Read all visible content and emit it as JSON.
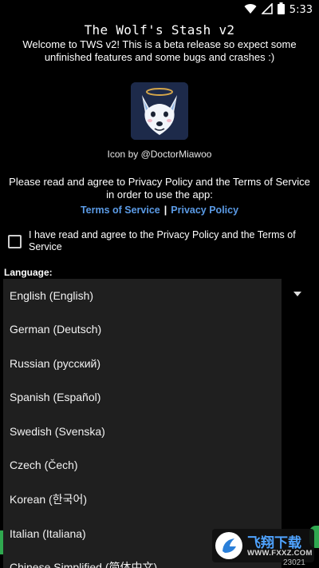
{
  "status_bar": {
    "time": "5:33",
    "icons": [
      "wifi-icon",
      "signal-icon",
      "battery-icon"
    ]
  },
  "app": {
    "title": "The Wolf's Stash v2",
    "welcome": "Welcome to TWS v2! This is a beta release so expect some unfinished features and some bugs and crashes :)",
    "icon_credit": "Icon by @DoctorMiawoo",
    "agree_prompt": "Please read and agree to Privacy Policy and the Terms of Service in order to use the app:",
    "links": {
      "terms": "Terms of Service",
      "separator": "|",
      "privacy": "Privacy Policy"
    },
    "checkbox_label": "I have read and agree to the Privacy Policy and the Terms of Service",
    "checkbox_checked": false,
    "language_label": "Language:",
    "selected_language": "English (English)",
    "language_options": [
      "English (English)",
      "German (Deutsch)",
      "Russian (русский)",
      "Spanish (Español)",
      "Swedish (Svenska)",
      "Czech (Čech)",
      "Korean (한국어)",
      "Italian (Italiana)",
      "Chinese Simplified (简体中文)"
    ]
  },
  "watermark": {
    "brand_cn": "飞翔下载",
    "url": "WWW.FXXZ.COM"
  },
  "footer": {
    "build_number": "23021"
  },
  "colors": {
    "background": "#000000",
    "link": "#5b9be6",
    "dropdown_bg": "#1f1f1f",
    "accent_green": "#2fa84f"
  }
}
